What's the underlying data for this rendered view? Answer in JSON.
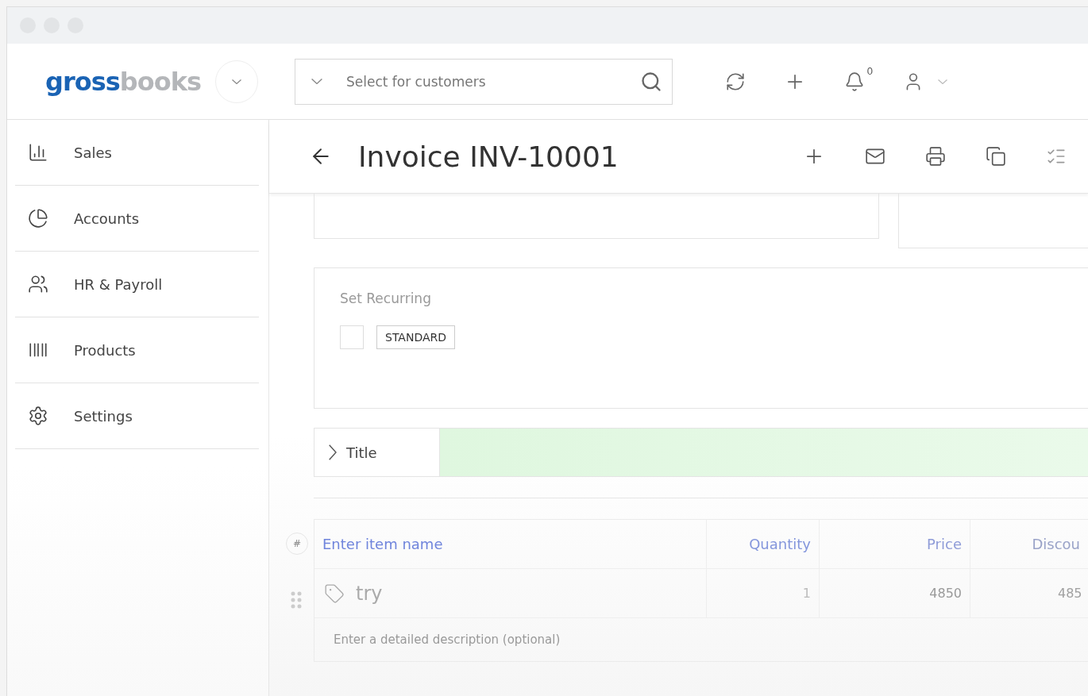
{
  "logo": {
    "first": "gross",
    "second": "books"
  },
  "search": {
    "placeholder": "Select for customers"
  },
  "notifications": {
    "count": "0"
  },
  "sidebar": {
    "items": [
      {
        "label": "Sales",
        "kind": "sales",
        "selected": false
      },
      {
        "label": "Accounts",
        "kind": "accounts",
        "selected": false
      },
      {
        "label": "HR & Payroll",
        "kind": "hr",
        "selected": false
      },
      {
        "label": "Products",
        "kind": "products",
        "selected": false
      },
      {
        "label": "Settings",
        "kind": "settings",
        "selected": false
      }
    ]
  },
  "page": {
    "title": "Invoice INV-10001"
  },
  "recurring": {
    "label": "Set Recurring",
    "checked": false,
    "type_button": "STANDARD"
  },
  "title_section": {
    "label": "Title",
    "expanded": false
  },
  "items_table": {
    "number_marker": "#",
    "columns": [
      "Enter item name",
      "Quantity",
      "Price",
      "Discou"
    ],
    "rows": [
      {
        "name": "try",
        "quantity": "1",
        "price": "4850",
        "discount": "485",
        "description_placeholder": "Enter a detailed description (optional)"
      }
    ]
  }
}
